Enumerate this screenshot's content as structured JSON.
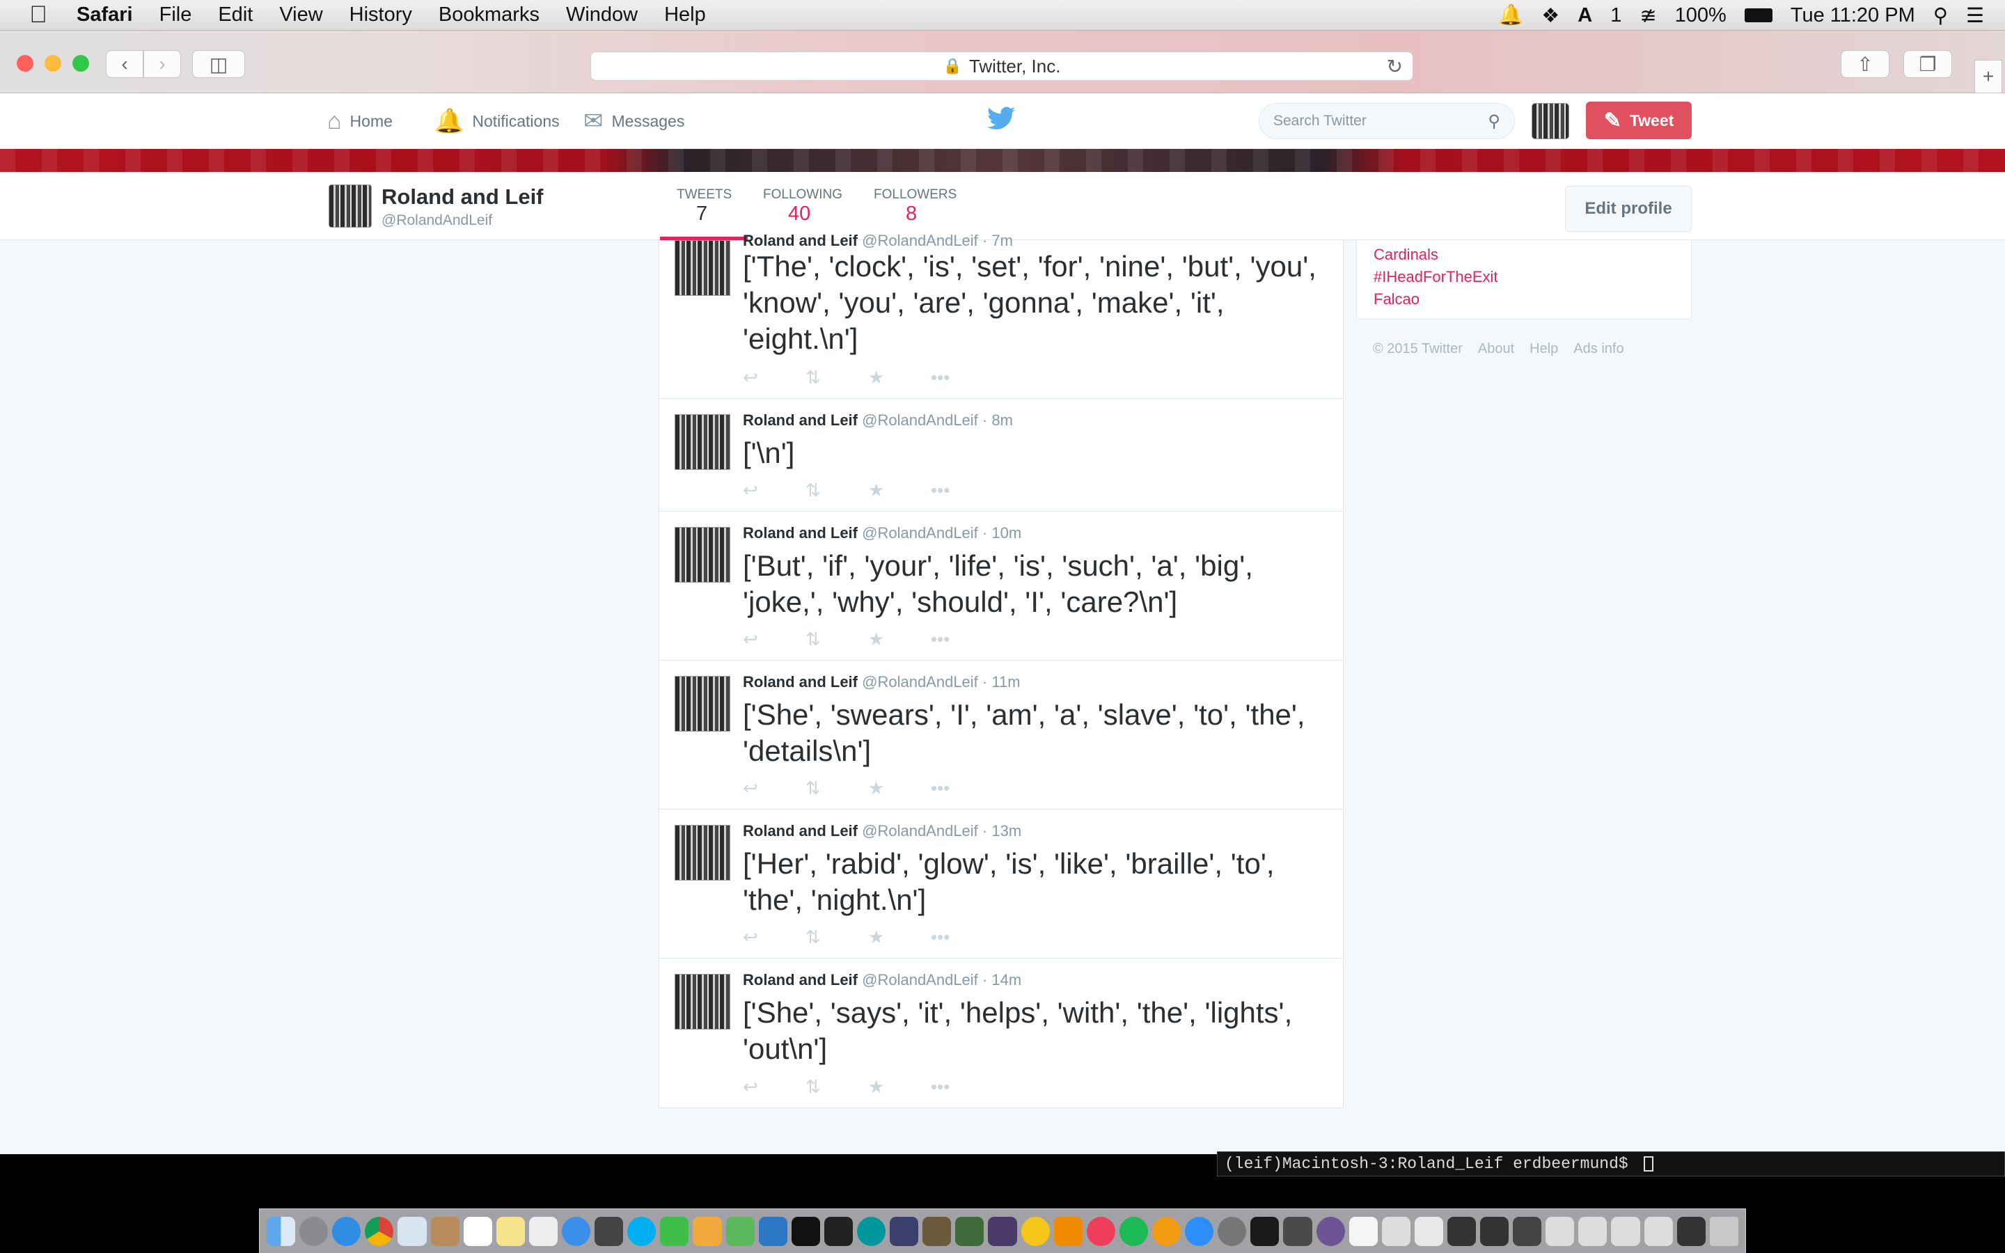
{
  "menubar": {
    "app_name": "Safari",
    "items": [
      "File",
      "Edit",
      "View",
      "History",
      "Bookmarks",
      "Window",
      "Help"
    ],
    "status": {
      "notif_count": "1",
      "battery": "100%",
      "clock": "Tue 11:20 PM"
    }
  },
  "browser": {
    "url_text": "Twitter, Inc."
  },
  "twitter": {
    "nav": {
      "home": "Home",
      "notifications": "Notifications",
      "messages": "Messages"
    },
    "search_placeholder": "Search Twitter",
    "tweet_button": "Tweet",
    "profile": {
      "name": "Roland and Leif",
      "handle": "@RolandAndLeif"
    },
    "stats": [
      {
        "label": "TWEETS",
        "value": "7"
      },
      {
        "label": "FOLLOWING",
        "value": "40"
      },
      {
        "label": "FOLLOWERS",
        "value": "8"
      }
    ],
    "edit_profile": "Edit profile",
    "trends": [
      "Cardinals",
      "#IHeadForTheExit",
      "Falcao"
    ],
    "footer": [
      "© 2015 Twitter",
      "About",
      "Help",
      "Ads info"
    ],
    "tweets": [
      {
        "name": "Roland and Leif",
        "handle": "@RolandAndLeif",
        "time": "· 7m",
        "text": "['The', 'clock', 'is', 'set', 'for', 'nine', 'but', 'you', 'know', 'you', 'are', 'gonna', 'make', 'it', 'eight.\\n']"
      },
      {
        "name": "Roland and Leif",
        "handle": "@RolandAndLeif",
        "time": "· 8m",
        "text": "['\\n']"
      },
      {
        "name": "Roland and Leif",
        "handle": "@RolandAndLeif",
        "time": "· 10m",
        "text": "['But', 'if', 'your', 'life', 'is', 'such', 'a', 'big', 'joke,', 'why', 'should', 'I', 'care?\\n']"
      },
      {
        "name": "Roland and Leif",
        "handle": "@RolandAndLeif",
        "time": "· 11m",
        "text": "['She', 'swears', 'I', 'am', 'a', 'slave', 'to', 'the', 'details\\n']"
      },
      {
        "name": "Roland and Leif",
        "handle": "@RolandAndLeif",
        "time": "· 13m",
        "text": "['Her', 'rabid', 'glow', 'is', 'like', 'braille', 'to', 'the', 'night.\\n']"
      },
      {
        "name": "Roland and Leif",
        "handle": "@RolandAndLeif",
        "time": "· 14m",
        "text": "['She', 'says', 'it', 'helps', 'with', 'the', 'lights', 'out\\n']"
      }
    ],
    "colors": {
      "accent": "#e0245e",
      "tweet_button": "#e0505f",
      "bird": "#55acee"
    }
  },
  "terminal": {
    "prompt": "(leif)Macintosh-3:Roland_Leif erdbeermund$"
  }
}
